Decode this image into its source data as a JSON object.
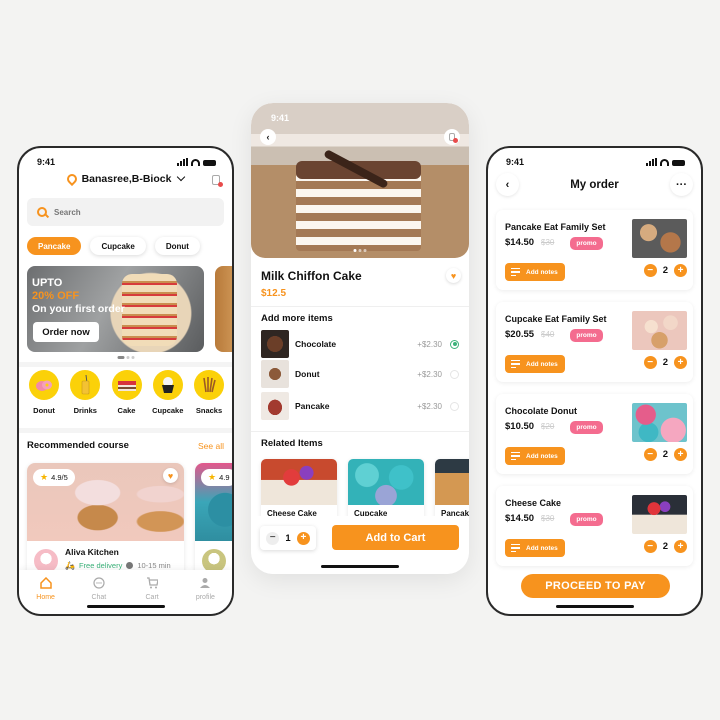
{
  "colors": {
    "accent": "#f7931e",
    "promo": "#f46c8f",
    "success": "#3bb27a",
    "category_bg": "#fbd109"
  },
  "home": {
    "status_time": "9:41",
    "location": "Banasree,B-Biock",
    "search_placeholder": "Search",
    "chips": [
      {
        "label": "Pancake",
        "active": true
      },
      {
        "label": "Cupcake",
        "active": false
      },
      {
        "label": "Donut",
        "active": false
      }
    ],
    "banner": {
      "line1": "UPTO",
      "line2": "20% OFF",
      "line3": "On your first order",
      "button": "Order now"
    },
    "categories": [
      {
        "label": "Donut",
        "icon": "donut-icon"
      },
      {
        "label": "Drinks",
        "icon": "drink-icon"
      },
      {
        "label": "Cake",
        "icon": "cake-icon"
      },
      {
        "label": "Cupcake",
        "icon": "cupcake-icon"
      },
      {
        "label": "Snacks",
        "icon": "snacks-icon"
      }
    ],
    "recommended": {
      "title": "Recommended course",
      "see_all": "See all",
      "cards": [
        {
          "rating": "4.9/5",
          "name": "Aliva Kitchen",
          "delivery": "Free delivery",
          "time": "10-15 min"
        },
        {
          "rating": "4.9"
        }
      ]
    },
    "tabs": [
      {
        "label": "Home",
        "icon": "home-icon",
        "active": true
      },
      {
        "label": "Chat",
        "icon": "chat-icon",
        "active": false
      },
      {
        "label": "Cart",
        "icon": "cart-icon",
        "active": false
      },
      {
        "label": "profile",
        "icon": "profile-icon",
        "active": false
      }
    ]
  },
  "detail": {
    "status_time": "9:41",
    "title": "Milk Chiffon Cake",
    "price": "$12.5",
    "add_more_title": "Add more items",
    "addons": [
      {
        "name": "Chocolate",
        "price": "+$2.30",
        "selected": true
      },
      {
        "name": "Donut",
        "price": "+$2.30",
        "selected": false
      },
      {
        "name": "Pancake",
        "price": "+$2.30",
        "selected": false
      }
    ],
    "related_title": "Related Items",
    "related": [
      {
        "name": "Cheese Cake"
      },
      {
        "name": "Cupcake"
      },
      {
        "name": "Pancake"
      }
    ],
    "quantity": "1",
    "add_to_cart": "Add to Cart"
  },
  "order": {
    "status_time": "9:41",
    "title": "My order",
    "items": [
      {
        "name": "Pancake Eat Family Set",
        "price": "$14.50",
        "old_price": "$30",
        "promo": "promo",
        "notes": "Add notes",
        "qty": "2"
      },
      {
        "name": "Cupcake Eat Family Set",
        "price": "$20.55",
        "old_price": "$40",
        "promo": "promo",
        "notes": "Add notes",
        "qty": "2"
      },
      {
        "name": "Chocolate Donut",
        "price": "$10.50",
        "old_price": "$20",
        "promo": "promo",
        "notes": "Add notes",
        "qty": "2"
      },
      {
        "name": "Cheese Cake",
        "price": "$14.50",
        "old_price": "$30",
        "promo": "promo",
        "notes": "Add notes",
        "qty": "2"
      }
    ],
    "proceed": "PROCEED TO PAY"
  }
}
